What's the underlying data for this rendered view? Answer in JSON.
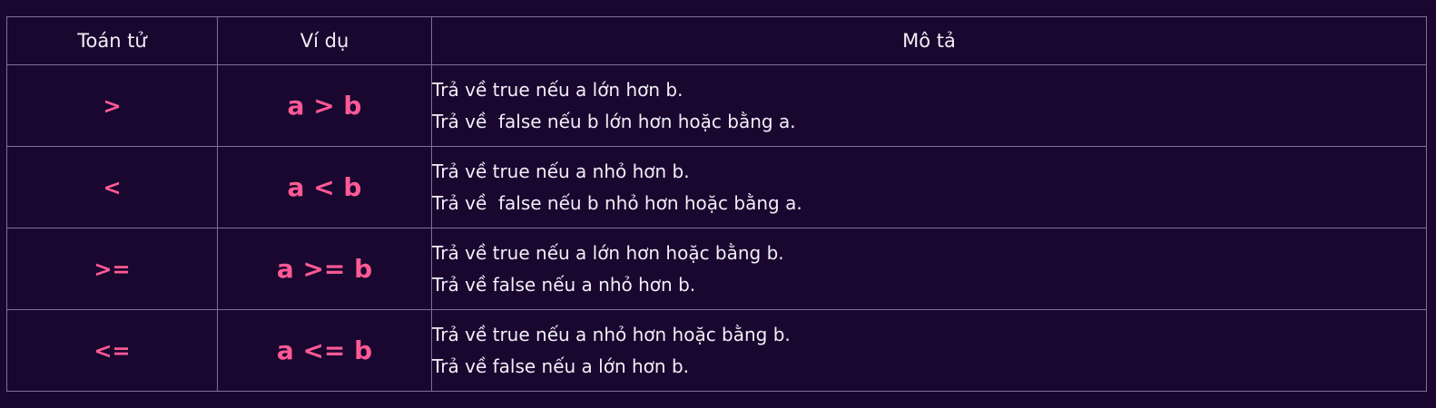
{
  "table": {
    "headers": [
      "Toán tử",
      "Ví dụ",
      "Mô tả"
    ],
    "rows": [
      {
        "operator": ">",
        "example": "a > b",
        "desc_line1": "Trả về true nếu a lớn hơn b.",
        "desc_line2": "Trả về  false nếu b lớn hơn hoặc bằng a."
      },
      {
        "operator": "<",
        "example": "a < b",
        "desc_line1": "Trả về true nếu a nhỏ hơn b.",
        "desc_line2": "Trả về  false nếu b nhỏ hơn hoặc bằng a."
      },
      {
        "operator": ">=",
        "example": "a >= b",
        "desc_line1": "Trả về true nếu a lớn hơn hoặc bằng b.",
        "desc_line2": "Trả về false nếu a nhỏ hơn b."
      },
      {
        "operator": "<=",
        "example": "a <= b",
        "desc_line1": "Trả về true nếu a nhỏ hơn hoặc bằng b.",
        "desc_line2": "Trả về false nếu a lớn hơn b."
      }
    ]
  },
  "colors": {
    "background": "#19072f",
    "border": "#7f6f98",
    "accent": "#ff5a95",
    "text": "#f2eef7"
  }
}
